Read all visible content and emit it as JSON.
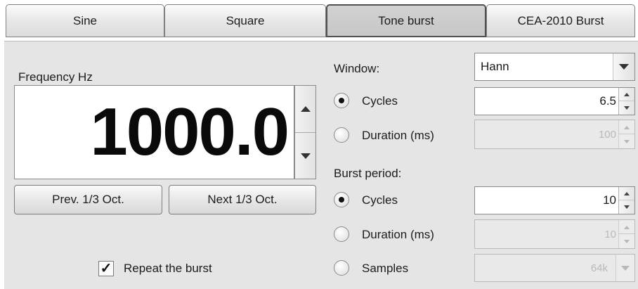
{
  "tabs": [
    {
      "label": "Sine",
      "active": false
    },
    {
      "label": "Square",
      "active": false
    },
    {
      "label": "Tone burst",
      "active": true
    },
    {
      "label": "CEA-2010 Burst",
      "active": false
    }
  ],
  "frequency": {
    "label": "Frequency Hz",
    "value": "1000.0",
    "prev_button": "Prev. 1/3 Oct.",
    "next_button": "Next 1/3 Oct."
  },
  "repeat": {
    "label": "Repeat the burst",
    "checked": true
  },
  "window": {
    "label": "Window:",
    "selected": "Hann",
    "cycles": {
      "label": "Cycles",
      "selected": true,
      "value": "6.5",
      "enabled": true
    },
    "duration": {
      "label": "Duration (ms)",
      "selected": false,
      "value": "100",
      "enabled": false
    }
  },
  "burst_period": {
    "label": "Burst period:",
    "cycles": {
      "label": "Cycles",
      "selected": true,
      "value": "10",
      "enabled": true
    },
    "duration": {
      "label": "Duration (ms)",
      "selected": false,
      "value": "10",
      "enabled": false
    },
    "samples": {
      "label": "Samples",
      "selected": false,
      "value": "64k",
      "enabled": false
    }
  },
  "icons": {
    "spin_up": "triangle-up-icon",
    "spin_down": "triangle-down-icon",
    "dropdown": "triangle-down-icon",
    "check": "checkmark-icon"
  },
  "colors": {
    "panel_bg": "#e5e5e5",
    "active_tab_bg": "#c8c8c8",
    "disabled_text": "#b9b9b9"
  }
}
